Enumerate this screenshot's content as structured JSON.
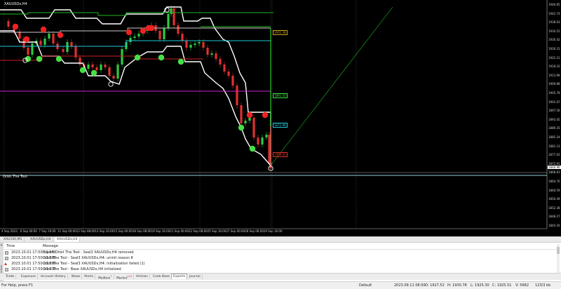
{
  "chart": {
    "symbol_label": "XAUUSDx,H4",
    "indicator_label": "Orbit The Tool",
    "price_ticks": [
      "1946.85",
      "1942.74",
      "1938.63",
      "1934.52",
      "1930.42",
      "1926.31",
      "1922.21",
      "1918.10",
      "1913.99",
      "1909.88",
      "1905.78",
      "1901.67",
      "1897.56",
      "1893.45",
      "1889.35",
      "1885.24",
      "1881.13",
      "1877.02",
      "1872.91",
      "1868.81",
      "1864.70",
      "1860.59",
      "1856.49",
      "1852.38",
      "1848.27",
      "1844.16"
    ],
    "current_price_tag": "1846.96",
    "line_labels": {
      "green": "1931.28",
      "light_green": "1891.03",
      "cyan": "1872.98",
      "red": "1859.83"
    },
    "time_ticks": [
      "4 Sep 2023",
      "6 Sep 00:00",
      "7 Sep 16:00",
      "11 Sep 00:00",
      "12 Sep 08:00",
      "13 Sep 16:00",
      "15 Sep 00:00",
      "18 Sep 08:00",
      "19 Sep 16:00",
      "21 Sep 00:00",
      "22 Sep 08:00",
      "25 Sep 16:00",
      "27 Sep 00:00",
      "28 Sep 08:00",
      "29 Sep 16:00"
    ]
  },
  "symbol_tabs": [
    "XAU100,M5",
    "XAUUSDx,H4",
    "XAUUSDx,H4"
  ],
  "toolbox": {
    "strip_label": "Toolbox",
    "close_glyph": "×",
    "columns": {
      "time": "Time",
      "message": "Message"
    },
    "rows": [
      {
        "type": "info",
        "time": "2023.10.01 17:50:11.580",
        "message": "Expert Orbit The Tool - Seal3 XAUUSDx,H4 removed"
      },
      {
        "type": "info",
        "time": "2023.10.01 17:50:11.580",
        "message": "Orbit The Tool - Seal3 XAUUSDx,H4: uninit reason 8"
      },
      {
        "type": "warning",
        "time": "2023.10.01 17:50:11.580",
        "message": "Orbit The Tool - Seal3 XAUUSDx,H4: initialization failed (1)"
      },
      {
        "type": "info",
        "time": "2023.10.01 17:50:11.330",
        "message": "Orbit The Tool - Base XAUUSDx,H4 initialized"
      }
    ],
    "tabs": [
      {
        "label": "Trade",
        "badge": ""
      },
      {
        "label": "Exposure",
        "badge": ""
      },
      {
        "label": "Account History",
        "badge": ""
      },
      {
        "label": "News",
        "badge": ""
      },
      {
        "label": "Alerts",
        "badge": ""
      },
      {
        "label": "Mailbox",
        "badge": "7"
      },
      {
        "label": "Market",
        "badge": "115"
      },
      {
        "label": "Articles",
        "badge": ""
      },
      {
        "label": "Code Base",
        "badge": ""
      },
      {
        "label": "Experts",
        "badge": ""
      },
      {
        "label": "Journal",
        "badge": ""
      }
    ],
    "active_tab": "Experts"
  },
  "status_bar": {
    "help": "For Help, press F1",
    "profile": "Default",
    "datetime": "2023.09.11 08:00",
    "open": "O: 1927.52",
    "high": "H: 1930.78",
    "low": "L: 1925.30",
    "close": "C: 1925.51",
    "volume": "V: 5682",
    "traffic": "123/3 kb"
  },
  "colors": {
    "bull_candle": "#2ecc40",
    "bear_candle": "#e03030",
    "envelope": "#ffffff",
    "green_line": "#22b822",
    "cyan_line": "#20c8d8",
    "magenta_line": "#cc22cc",
    "red_line": "#cc2020",
    "buy_marker": "#44e044",
    "sell_marker": "#ee2222"
  }
}
